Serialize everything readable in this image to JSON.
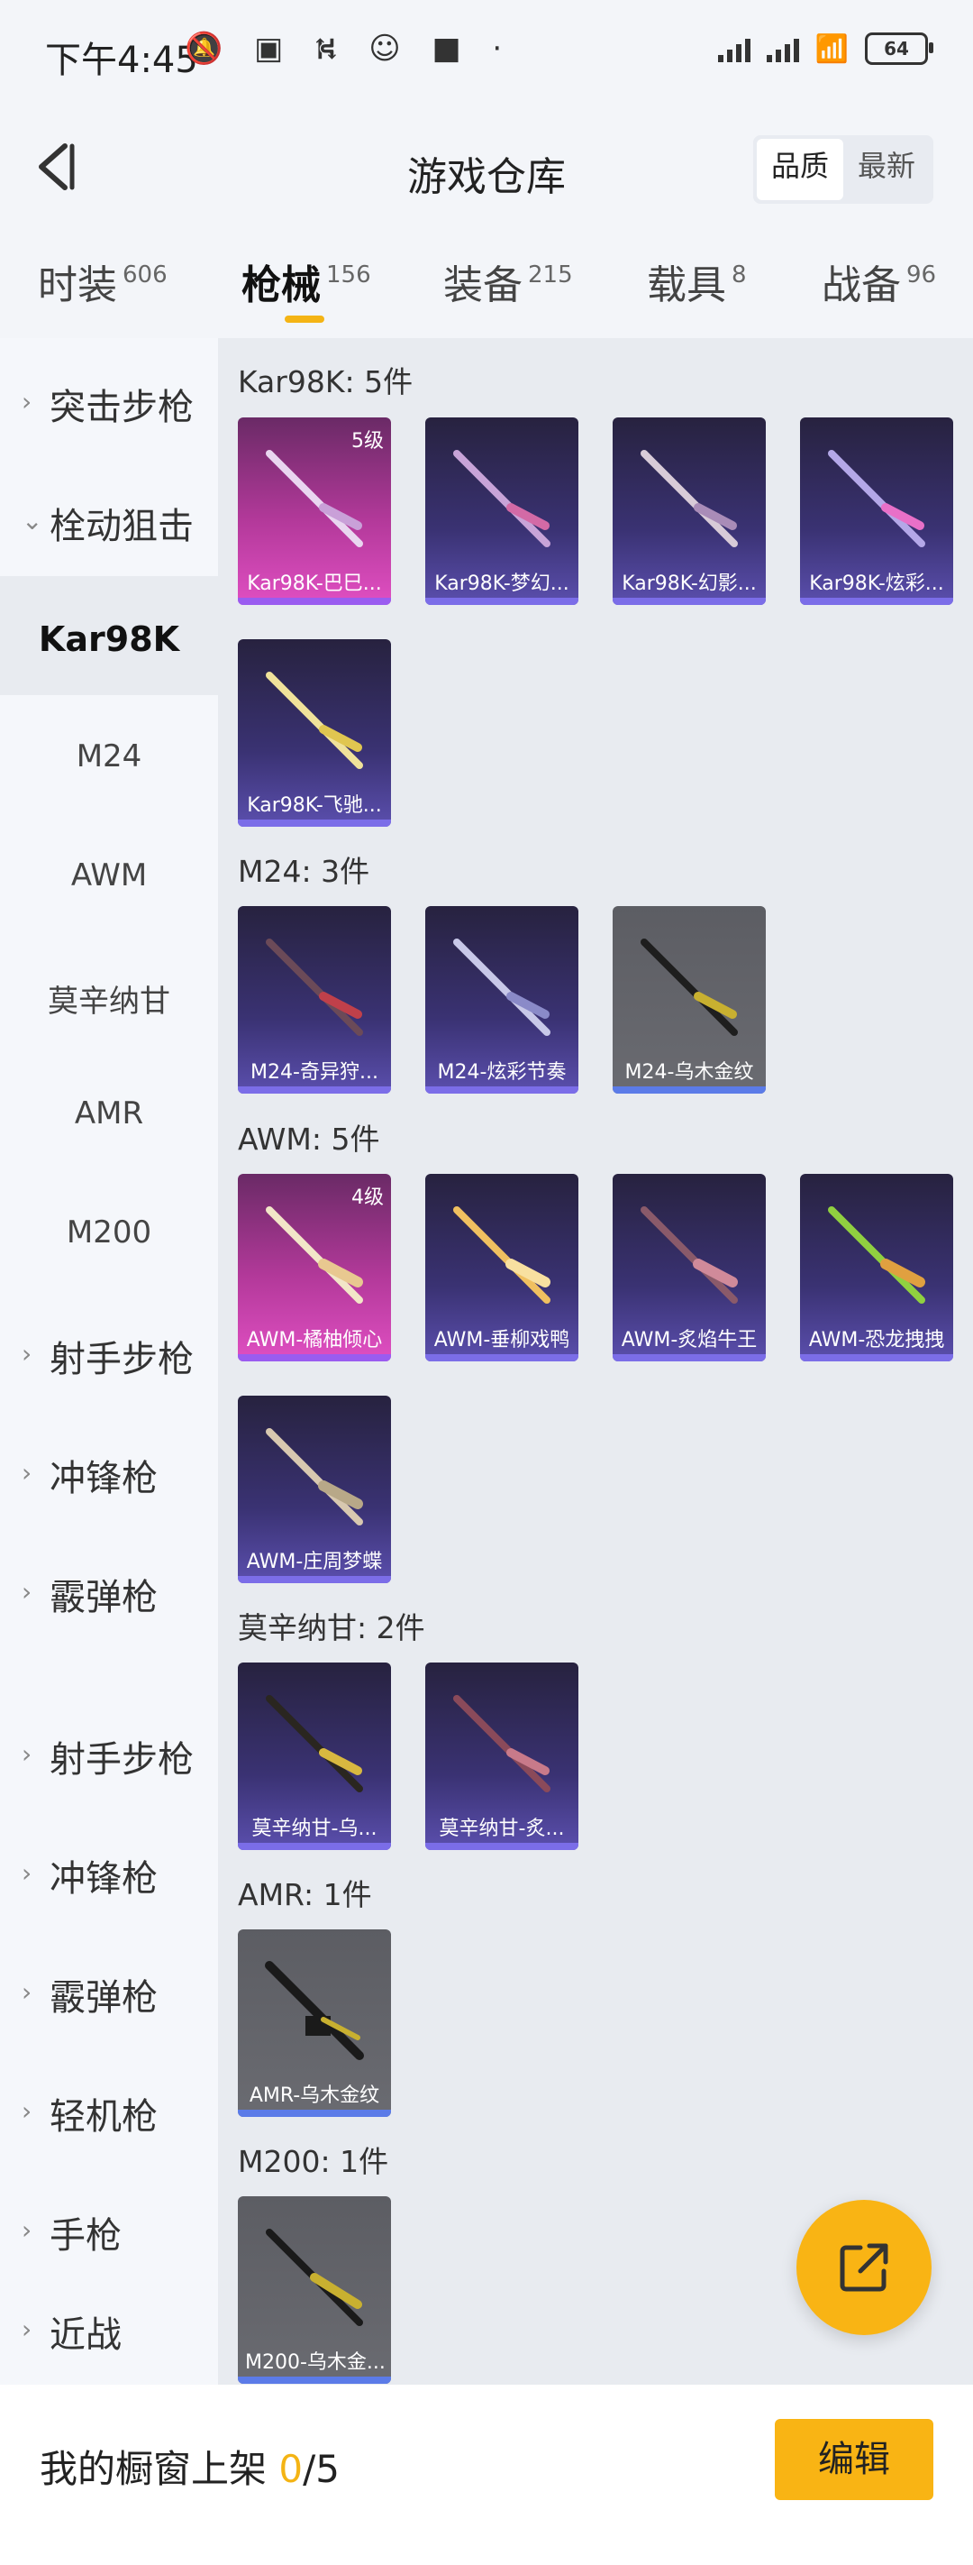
{
  "status_bar": {
    "time": "下午4:45",
    "battery": "64"
  },
  "header": {
    "title": "游戏仓库",
    "sort": [
      "品质",
      "最新"
    ]
  },
  "tabs": [
    {
      "label": "时装",
      "count": "606"
    },
    {
      "label": "枪械",
      "count": "156"
    },
    {
      "label": "装备",
      "count": "215"
    },
    {
      "label": "载具",
      "count": "8"
    },
    {
      "label": "战备",
      "count": "96"
    }
  ],
  "sidebar": [
    {
      "label": "突击步枪"
    },
    {
      "label": "栓动狙击"
    },
    {
      "label": "Kar98K"
    },
    {
      "label": "M24"
    },
    {
      "label": "AWM"
    },
    {
      "label": "莫辛纳甘"
    },
    {
      "label": "AMR"
    },
    {
      "label": "M200"
    },
    {
      "label": "射手步枪"
    },
    {
      "label": "冲锋枪"
    },
    {
      "label": "霰弹枪"
    },
    {
      "label": "射手步枪"
    },
    {
      "label": "冲锋枪"
    },
    {
      "label": "霰弹枪"
    },
    {
      "label": "轻机枪"
    },
    {
      "label": "手枪"
    },
    {
      "label": "近战"
    }
  ],
  "groups": [
    {
      "title": "Kar98K: 5件",
      "items": [
        {
          "name": "Kar98K-巴巳...",
          "level": "5级",
          "rarity": "legend"
        },
        {
          "name": "Kar98K-梦幻...",
          "rarity": "epic"
        },
        {
          "name": "Kar98K-幻影...",
          "rarity": "epic"
        },
        {
          "name": "Kar98K-炫彩...",
          "rarity": "epic"
        },
        {
          "name": "Kar98K-飞驰...",
          "rarity": "epic"
        }
      ]
    },
    {
      "title": "M24: 3件",
      "items": [
        {
          "name": "M24-奇异狩...",
          "rarity": "epic"
        },
        {
          "name": "M24-炫彩节奏",
          "rarity": "epic"
        },
        {
          "name": "M24-乌木金纹",
          "rarity": "gray"
        }
      ]
    },
    {
      "title": "AWM: 5件",
      "items": [
        {
          "name": "AWM-橘柚倾心",
          "level": "4级",
          "rarity": "legend"
        },
        {
          "name": "AWM-垂柳戏鸭",
          "rarity": "epic"
        },
        {
          "name": "AWM-炙焰牛王",
          "rarity": "epic"
        },
        {
          "name": "AWM-恐龙拽拽",
          "rarity": "epic"
        },
        {
          "name": "AWM-庄周梦蝶",
          "rarity": "epic"
        }
      ]
    },
    {
      "title": "莫辛纳甘: 2件",
      "items": [
        {
          "name": "莫辛纳甘-乌...",
          "rarity": "epic"
        },
        {
          "name": "莫辛纳甘-炙...",
          "rarity": "epic"
        }
      ]
    },
    {
      "title": "AMR: 1件",
      "items": [
        {
          "name": "AMR-乌木金纹",
          "rarity": "gray"
        }
      ]
    },
    {
      "title": "M200: 1件",
      "items": [
        {
          "name": "M200-乌木金...",
          "rarity": "gray"
        }
      ]
    }
  ],
  "showcase": {
    "label": "我的橱窗上架",
    "current": "0",
    "total": "/5",
    "edit_label": "编辑"
  },
  "colors": {
    "accent": "#f9b414",
    "legend": "#e04fc2",
    "epic": "#5b4fae"
  }
}
